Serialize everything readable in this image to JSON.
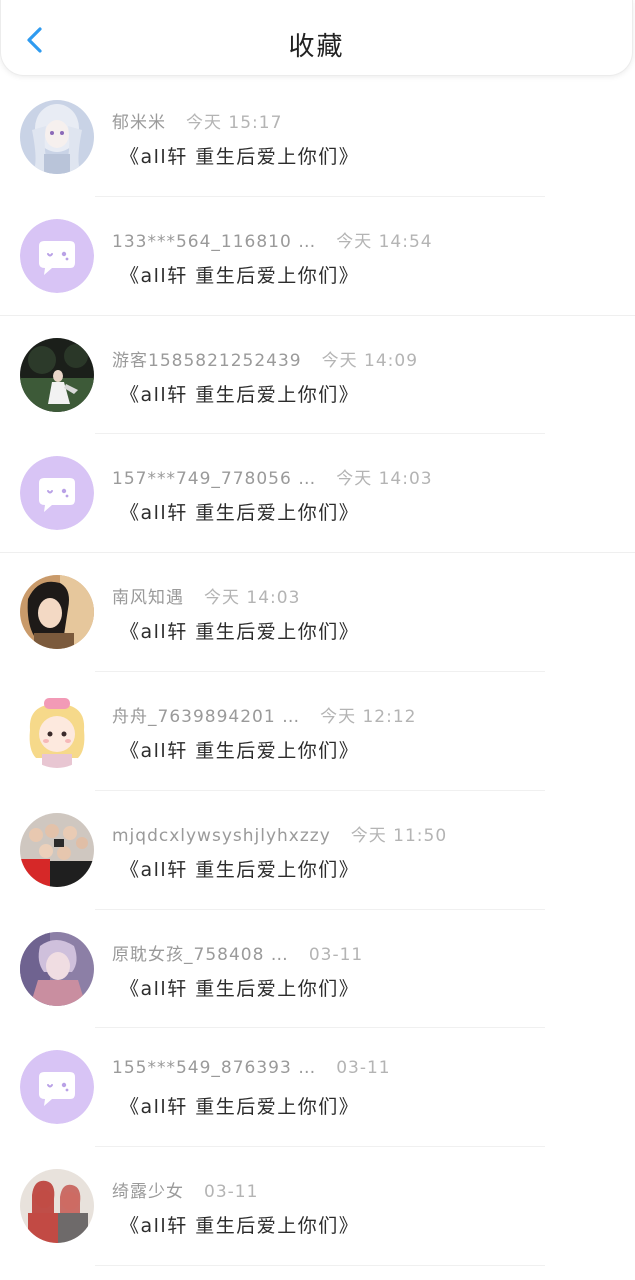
{
  "header": {
    "title": "收藏",
    "back_icon": "chevron-left-icon",
    "accent_color": "#2f9bf0"
  },
  "items": [
    {
      "user": "郁米米",
      "time": "今天 15:17",
      "book": "《all轩 重生后爱上你们》",
      "avatar": "anime-girl-avatar"
    },
    {
      "user": "133***564_116810 …",
      "time": "今天 14:54",
      "book": "《all轩 重生后爱上你们》",
      "avatar": "default-chat-avatar"
    },
    {
      "user": "游客1585821252439",
      "time": "今天 14:09",
      "book": "《all轩 重生后爱上你们》",
      "avatar": "photo-avatar"
    },
    {
      "user": "157***749_778056 …",
      "time": "今天 14:03",
      "book": "《all轩 重生后爱上你们》",
      "avatar": "default-chat-avatar"
    },
    {
      "user": "南风知遇",
      "time": "今天 14:03",
      "book": "《all轩 重生后爱上你们》",
      "avatar": "illustration-avatar"
    },
    {
      "user": "舟舟_7639894201 …",
      "time": "今天 12:12",
      "book": "《all轩 重生后爱上你们》",
      "avatar": "cartoon-girl-avatar"
    },
    {
      "user": "mjqdcxlywsyshjlyhxzzy",
      "time": "今天 11:50",
      "book": "《all轩 重生后爱上你们》",
      "avatar": "group-photo-avatar"
    },
    {
      "user": "原耽女孩_758408 …",
      "time": "03-11",
      "book": "《all轩 重生后爱上你们》",
      "avatar": "anime-boy-avatar"
    },
    {
      "user": "155***549_876393 …",
      "time": "03-11",
      "book": "《all轩 重生后爱上你们》",
      "avatar": "default-chat-avatar"
    },
    {
      "user": "绮露少女",
      "time": "03-11",
      "book": "《all轩 重生后爱上你们》",
      "avatar": "duo-photo-avatar"
    }
  ],
  "colors": {
    "default_avatar_bg": "#d8c4f5",
    "meta_text": "#9a9a9a",
    "book_text": "#2c2c2c"
  }
}
